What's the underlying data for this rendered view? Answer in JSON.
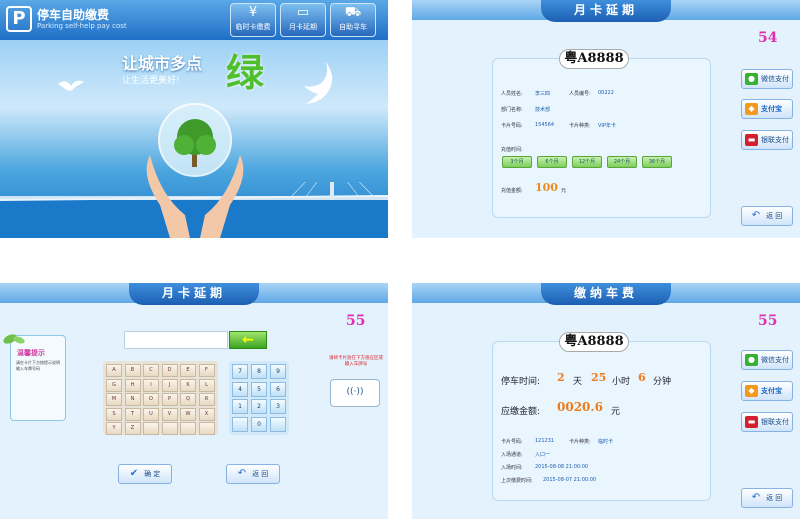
{
  "home": {
    "brand": "停车自助缴费",
    "brand_sub": "Parking self-help pay cost",
    "nav": [
      {
        "label": "临时卡缴费",
        "icon": "¥"
      },
      {
        "label": "月卡延期",
        "icon": "card"
      },
      {
        "label": "自助寻车",
        "icon": "car"
      }
    ],
    "slogan": "让城市多点",
    "slogan_sub": "让生活更美好!",
    "green": "绿"
  },
  "extend": {
    "title": "月卡延期",
    "counter": "54",
    "plate": "粤A8888",
    "labels": {
      "name": "人员姓名:",
      "id": "人员编号:",
      "dept": "部门名称:",
      "card_no": "卡片号码:",
      "card_type": "卡片种类:",
      "time": "充值时间:",
      "amount": "充值金额:",
      "unit": "元"
    },
    "values": {
      "name": "李三四",
      "id": "00222",
      "dept": "技术部",
      "card_no": "154564",
      "card_type": "VIP年卡",
      "amount": "100"
    },
    "months": [
      "3个月",
      "6个月",
      "12个月",
      "24个月",
      "36个月"
    ],
    "pay": {
      "wechat": "微信支付",
      "alipay": "支付宝",
      "union": "银联支付"
    },
    "back": "返  回"
  },
  "keyboard": {
    "title": "月卡延期",
    "counter": "55",
    "tip_title": "温馨提示",
    "tip_text": "请在卡片下方按提示说明输入车牌号码",
    "hint": "请将卡片放在下方感应区或输入车牌号",
    "letters": [
      "A",
      "B",
      "C",
      "D",
      "E",
      "F",
      "G",
      "H",
      "I",
      "J",
      "K",
      "L",
      "M",
      "N",
      "O",
      "P",
      "Q",
      "R",
      "S",
      "T",
      "U",
      "V",
      "W",
      "X",
      "Y",
      "Z"
    ],
    "numbers": [
      "7",
      "8",
      "9",
      "4",
      "5",
      "6",
      "1",
      "2",
      "3",
      "0"
    ],
    "confirm": "确  定",
    "back": "返  回"
  },
  "fee": {
    "title": "缴纳车费",
    "counter": "55",
    "plate": "粤A8888",
    "time_label": "停车时间:",
    "days": "2",
    "day_unit": "天",
    "hours": "25",
    "hour_unit": "小时",
    "minutes": "6",
    "min_unit": "分钟",
    "amount_label": "应缴金额:",
    "amount": "0020.6",
    "amount_unit": "元",
    "labels": {
      "card_no": "卡片号码:",
      "card_type": "卡片种类:",
      "lane": "入场通道:",
      "entry": "入场时间:",
      "last": "上次缴费时间:"
    },
    "values": {
      "card_no": "121231",
      "card_type": "临时卡",
      "lane": "入口一",
      "entry": "2015-08-08 21:00:00",
      "last": "2015-08-07 21:00:00"
    },
    "pay": {
      "wechat": "微信支付",
      "alipay": "支付宝",
      "union": "银联支付"
    },
    "back": "返  回"
  }
}
